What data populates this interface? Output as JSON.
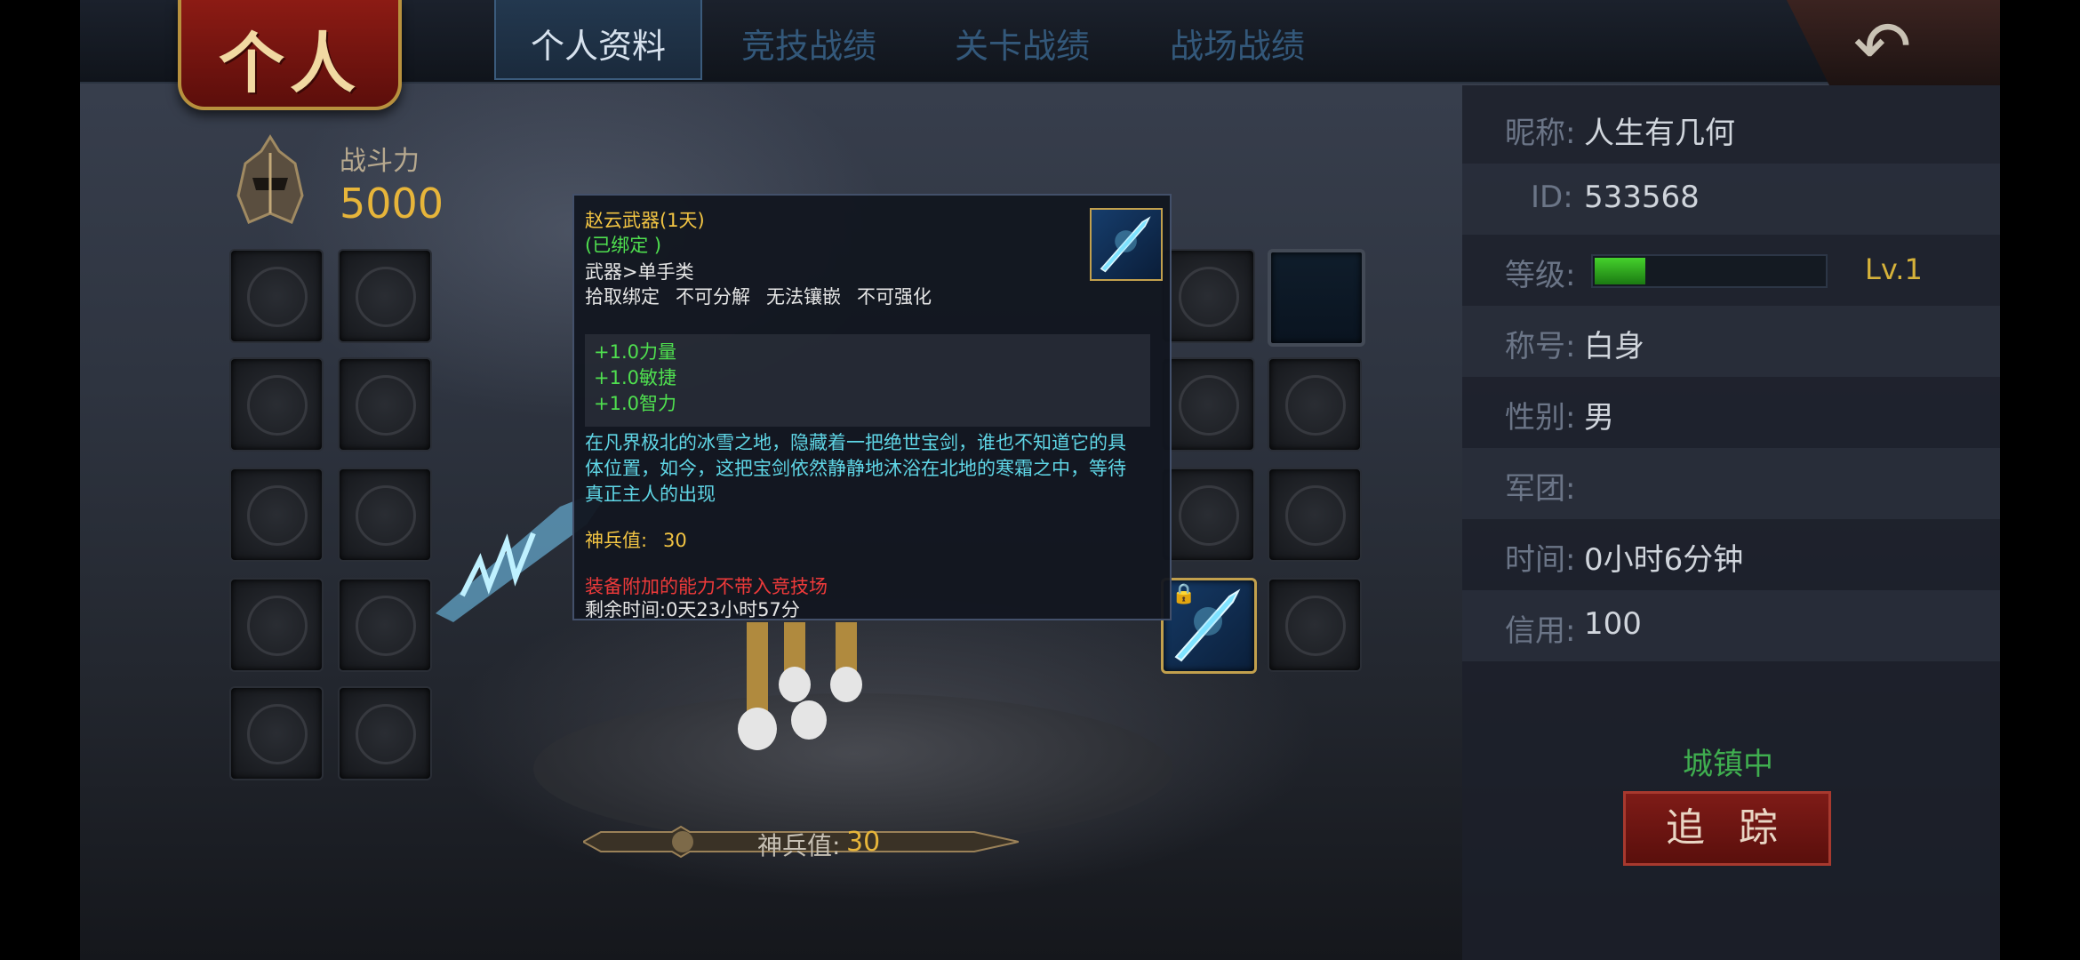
{
  "header": {
    "banner_title": "个人",
    "tabs": [
      {
        "label": "个人资料",
        "active": true
      },
      {
        "label": "竞技战绩",
        "active": false
      },
      {
        "label": "关卡战绩",
        "active": false
      },
      {
        "label": "战场战绩",
        "active": false
      }
    ],
    "back_icon": "back-arrow-icon"
  },
  "power": {
    "label": "战斗力",
    "value": "5000"
  },
  "shenbing_bar": {
    "label": "神兵值:",
    "value": "30"
  },
  "tooltip": {
    "name": "赵云武器(1天)",
    "bound": "(已绑定 )",
    "type": "武器>单手类",
    "flags": [
      "拾取绑定",
      "不可分解",
      "无法镶嵌",
      "不可强化"
    ],
    "stats": [
      "+1.0力量",
      "+1.0敏捷",
      "+1.0智力"
    ],
    "description": "在凡界极北的冰雪之地，隐藏着一把绝世宝剑，谁也不知道它的具体位置，如今，这把宝剑依然静静地沐浴在北地的寒霜之中，等待真正主人的出现",
    "shenbing_label": "神兵值:",
    "shenbing_value": "30",
    "warning": "装备附加的能力不带入竞技场",
    "remaining": "剩余时间:0天23小时57分",
    "colors": {
      "name": "#f2c443",
      "bound": "#4fe04f",
      "stats": "#4fe04f",
      "desc": "#5fd6e6",
      "warning": "#ee3a3a"
    }
  },
  "profile": {
    "nickname_label": "昵称:",
    "nickname": "人生有几何",
    "id_label": "ID:",
    "id": "533568",
    "level_label": "等级:",
    "level_progress": 0.22,
    "level": "Lv.1",
    "title_label": "称号:",
    "title": "白身",
    "gender_label": "性别:",
    "gender": "男",
    "legion_label": "军团:",
    "legion": "",
    "time_label": "时间:",
    "time": "0小时6分钟",
    "credit_label": "信用:",
    "credit": "100",
    "status": "城镇中",
    "track_button": "追 踪"
  }
}
